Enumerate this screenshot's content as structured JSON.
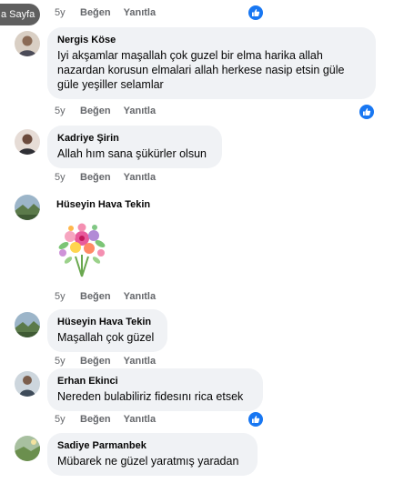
{
  "page_label": "a Sayfa",
  "comments": [
    {
      "author": "",
      "text": "",
      "age": "5y",
      "like_label": "Beğen",
      "reply_label": "Yanıtla",
      "has_like_badge": true
    },
    {
      "author": "Nergis Köse",
      "text": "Iyi akşamlar maşallah çok guzel bir elma harika allah nazardan korusun elmalari allah herkese nasip etsin güle güle yeşiller selamlar",
      "age": "5y",
      "like_label": "Beğen",
      "reply_label": "Yanıtla",
      "has_like_badge": true
    },
    {
      "author": "Kadriye Şirin",
      "text": "Allah hım sana şükürler olsun",
      "age": "5y",
      "like_label": "Beğen",
      "reply_label": "Yanıtla",
      "has_like_badge": false
    },
    {
      "author": "Hüseyin Hava Tekin",
      "text": "",
      "sticker": "flower-bouquet-sticker",
      "age": "5y",
      "like_label": "Beğen",
      "reply_label": "Yanıtla",
      "has_like_badge": false
    },
    {
      "author": "Hüseyin Hava Tekin",
      "text": "Maşallah çok güzel",
      "age": "5y",
      "like_label": "Beğen",
      "reply_label": "Yanıtla",
      "has_like_badge": false
    },
    {
      "author": "Erhan Ekinci",
      "text": "Nereden bulabiliriz fidesını rica etsek",
      "age": "5y",
      "like_label": "Beğen",
      "reply_label": "Yanıtla",
      "has_like_badge": true
    },
    {
      "author": "Sadiye Parmanbek",
      "text": "Mübarek ne güzel yaratmış yaradan",
      "age": "",
      "like_label": "",
      "reply_label": "",
      "has_like_badge": false
    }
  ],
  "colors": {
    "bubble_bg": "#f0f2f5",
    "meta_text": "#65676b",
    "like_blue": "#1877f2"
  },
  "icons": {
    "like": "thumbs-up-icon"
  }
}
